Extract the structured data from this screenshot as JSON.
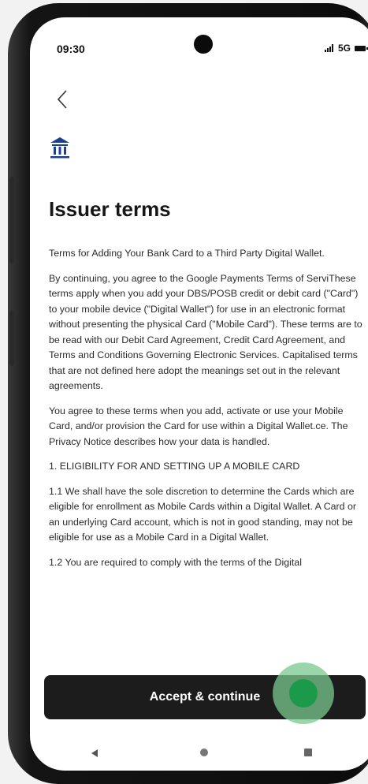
{
  "status_bar": {
    "time": "09:30",
    "network": "5G"
  },
  "header": {
    "title": "Issuer terms",
    "back_icon": "chevron-left-icon",
    "bank_icon": "bank-building-icon"
  },
  "terms": {
    "paragraphs": [
      "Terms for Adding Your Bank Card to a Third Party Digital Wallet.",
      "By continuing, you agree to the Google Payments Terms of ServiThese terms apply when you add your DBS/POSB credit or debit card (\"Card\") to your mobile device (\"Digital Wallet\") for use in an electronic format without presenting the physical Card (\"Mobile Card\"). These terms are to be read with our Debit Card Agreement, Credit Card Agreement, and Terms and Conditions Governing Electronic Services. Capitalised terms that are not defined here adopt the meanings set out in the relevant agreements.",
      "You agree to these terms when you add, activate or use your Mobile Card, and/or provision the Card for use within a Digital Wallet.ce. The Privacy Notice describes how your data is handled.",
      "1. ELIGIBILITY FOR AND SETTING UP A MOBILE CARD",
      "1.1 We shall have the sole discretion to determine the Cards which are eligible for enrollment as Mobile Cards within a Digital Wallet. A Card or an underlying Card account, which is not in good standing, may not be eligible for use as a Mobile Card in a Digital Wallet.",
      "1.2 You are required to comply with the terms of the Digital"
    ]
  },
  "actions": {
    "accept_label": "Accept & continue"
  },
  "colors": {
    "accent": "#1d3f8f",
    "button": "#1c1c1c",
    "tap_indicator": "#1a9a4a"
  }
}
